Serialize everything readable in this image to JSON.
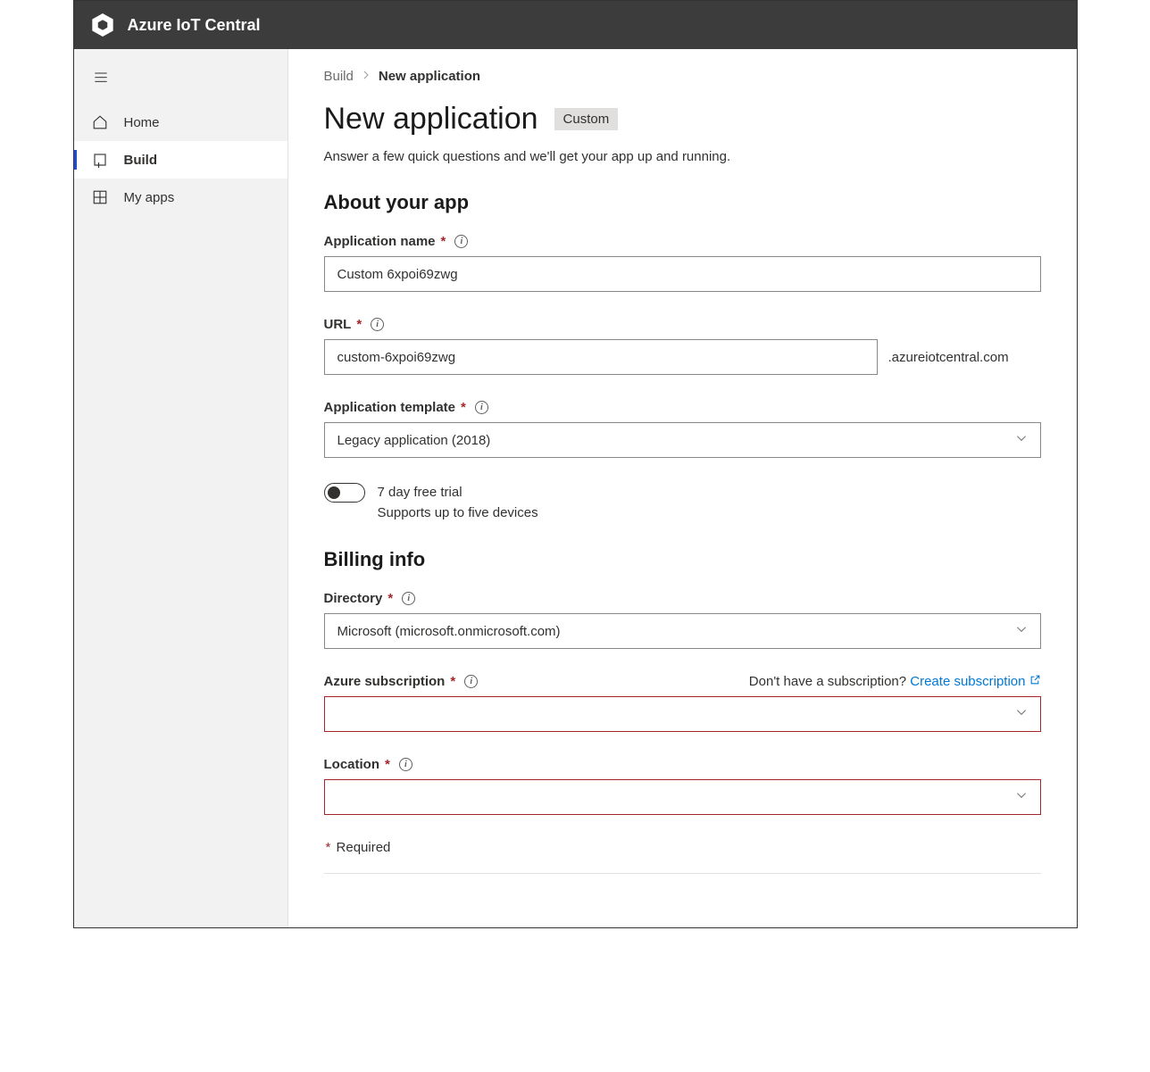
{
  "header": {
    "title": "Azure IoT Central"
  },
  "sidebar": {
    "items": [
      {
        "label": "Home",
        "icon": "home"
      },
      {
        "label": "Build",
        "icon": "build"
      },
      {
        "label": "My apps",
        "icon": "grid"
      }
    ]
  },
  "breadcrumb": {
    "parent": "Build",
    "current": "New application"
  },
  "page": {
    "title": "New application",
    "badge": "Custom",
    "subtitle": "Answer a few quick questions and we'll get your app up and running."
  },
  "sections": {
    "about": {
      "title": "About your app",
      "appName": {
        "label": "Application name",
        "value": "Custom 6xpoi69zwg"
      },
      "url": {
        "label": "URL",
        "value": "custom-6xpoi69zwg",
        "suffix": ".azureiotcentral.com"
      },
      "template": {
        "label": "Application template",
        "value": "Legacy application (2018)"
      },
      "trial": {
        "title": "7 day free trial",
        "sub": "Supports up to five devices"
      }
    },
    "billing": {
      "title": "Billing info",
      "directory": {
        "label": "Directory",
        "value": "Microsoft (microsoft.onmicrosoft.com)"
      },
      "subscription": {
        "label": "Azure subscription",
        "noSubMsg": "Don't have a subscription? ",
        "createLink": "Create subscription",
        "value": ""
      },
      "location": {
        "label": "Location",
        "value": ""
      }
    }
  },
  "requiredNote": "Required",
  "asterisk": "*",
  "infoGlyph": "i"
}
